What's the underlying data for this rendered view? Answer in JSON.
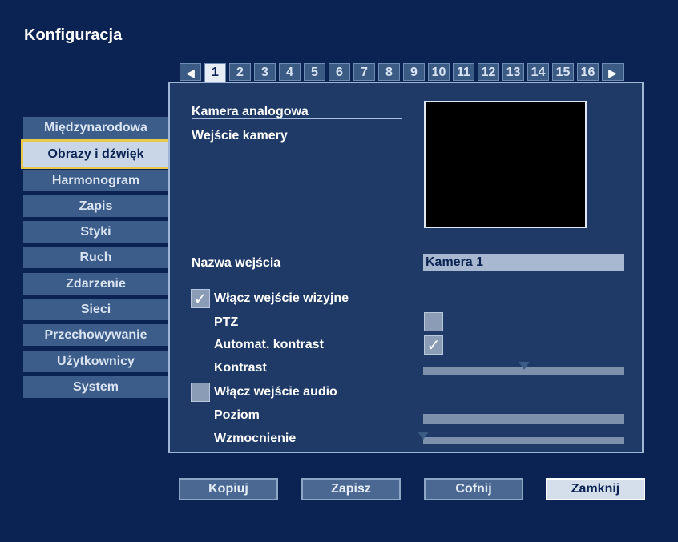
{
  "window": {
    "title": "Konfiguracja"
  },
  "tabs": {
    "prev_icon": "◀",
    "next_icon": "▶",
    "items": [
      "1",
      "2",
      "3",
      "4",
      "5",
      "6",
      "7",
      "8",
      "9",
      "10",
      "11",
      "12",
      "13",
      "14",
      "15",
      "16"
    ],
    "active": "1"
  },
  "sidebar": {
    "items": [
      {
        "label": "Międzynarodowa"
      },
      {
        "label": "Obrazy i dźwięk",
        "active": true
      },
      {
        "label": "Harmonogram"
      },
      {
        "label": "Zapis"
      },
      {
        "label": "Styki"
      },
      {
        "label": "Ruch"
      },
      {
        "label": "Zdarzenie"
      },
      {
        "label": "Sieci"
      },
      {
        "label": "Przechowywanie"
      },
      {
        "label": "Użytkownicy"
      },
      {
        "label": "System"
      }
    ]
  },
  "panel": {
    "heading": "Kamera analogowa",
    "camera_input_label": "Wejście kamery",
    "input_name_label": "Nazwa wejścia",
    "input_name_value": "Kamera 1",
    "enable_video_label": "Włącz wejście wizyjne",
    "enable_video_checked": true,
    "ptz_label": "PTZ",
    "ptz_checked": false,
    "auto_contrast_label": "Automat. kontrast",
    "auto_contrast_checked": true,
    "contrast_label": "Kontrast",
    "contrast_level": 0.5,
    "enable_audio_label": "Włącz wejście audio",
    "enable_audio_checked": false,
    "level_label": "Poziom",
    "gain_label": "Wzmocnienie",
    "gain_level": 0.0,
    "check_glyph": "✓"
  },
  "buttons": {
    "copy": "Kopiuj",
    "save": "Zapisz",
    "undo": "Cofnij",
    "close": "Zamknij"
  }
}
